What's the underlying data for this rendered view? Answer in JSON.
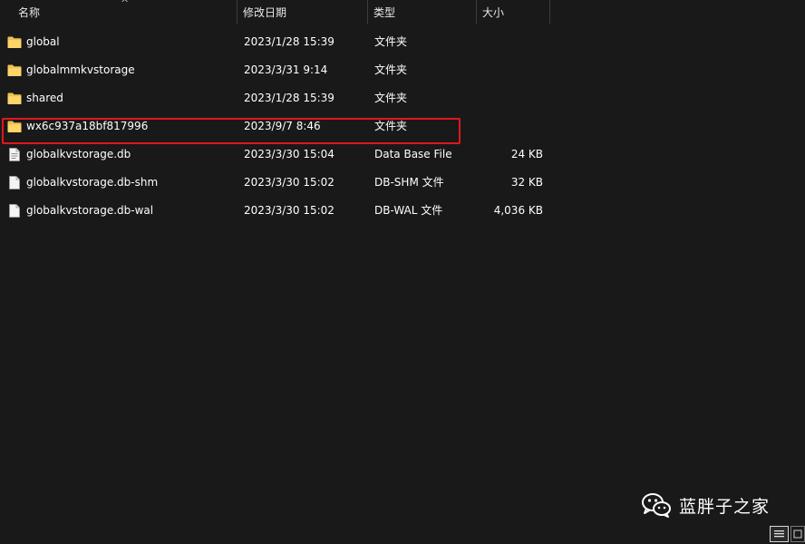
{
  "columns": {
    "name": "名称",
    "date": "修改日期",
    "type": "类型",
    "size": "大小"
  },
  "files": [
    {
      "icon": "folder-icon",
      "name": "global",
      "date": "2023/1/28 15:39",
      "type": "文件夹",
      "size": ""
    },
    {
      "icon": "folder-icon",
      "name": "globalmmkvstorage",
      "date": "2023/3/31 9:14",
      "type": "文件夹",
      "size": ""
    },
    {
      "icon": "folder-icon",
      "name": "shared",
      "date": "2023/1/28 15:39",
      "type": "文件夹",
      "size": ""
    },
    {
      "icon": "folder-icon",
      "name": "wx6c937a18bf817996",
      "date": "2023/9/7 8:46",
      "type": "文件夹",
      "size": ""
    },
    {
      "icon": "db-file-icon",
      "name": "globalkvstorage.db",
      "date": "2023/3/30 15:04",
      "type": "Data Base File",
      "size": "24 KB"
    },
    {
      "icon": "file-icon",
      "name": "globalkvstorage.db-shm",
      "date": "2023/3/30 15:02",
      "type": "DB-SHM 文件",
      "size": "32 KB"
    },
    {
      "icon": "file-icon",
      "name": "globalkvstorage.db-wal",
      "date": "2023/3/30 15:02",
      "type": "DB-WAL 文件",
      "size": "4,036 KB"
    }
  ],
  "watermark": {
    "icon": "wechat-icon",
    "text": "蓝胖子之家"
  },
  "colors": {
    "background": "#191919",
    "highlight": "#e0171e",
    "folder": "#f0c24b"
  }
}
